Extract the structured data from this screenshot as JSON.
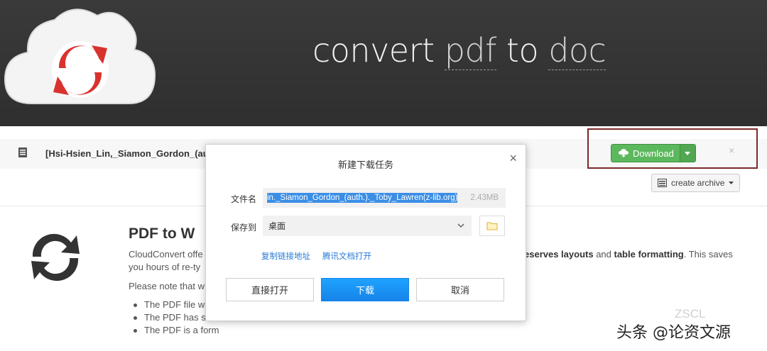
{
  "header": {
    "title_parts": [
      "convert",
      "pdf",
      "to",
      "doc"
    ]
  },
  "file": {
    "name": "[Hsi-Hsien_Lin,_Siamon_Gordon_(au"
  },
  "actions": {
    "download_label": "Download",
    "close_glyph": "×",
    "archive_label": "create archive"
  },
  "content": {
    "title": "PDF to W",
    "line1_left": "CloudConvert offe",
    "line1_right_bold1": "eserves layouts",
    "line1_right_mid": " and ",
    "line1_right_bold2": "table formatting",
    "line1_right_end": ". This saves",
    "line2": "you hours of re-ty",
    "note": "Please note that w",
    "bullets": [
      "The PDF file w",
      "The PDF has se",
      "The PDF is a form"
    ]
  },
  "dialog": {
    "title": "新建下载任务",
    "filename_label": "文件名",
    "filename_value": "in._Siamon_Gordon_(auth.)._Toby_Lawren(z-lib.org)",
    "file_size": "2.43MB",
    "save_label": "保存到",
    "save_path": "桌面",
    "link_copy": "复制链接地址",
    "link_tencent": "腾讯文档打开",
    "btn_open": "直接打开",
    "btn_download": "下载",
    "btn_cancel": "取消"
  },
  "watermark": {
    "text": "头条 @论资文源",
    "faint": "ZSCL"
  },
  "colors": {
    "header_bg": "#333333",
    "download_green": "#5cb85c",
    "highlight_border": "#7b2a2a",
    "dialog_primary": "#1684e8",
    "logo_red": "#d9322e"
  },
  "icons": {
    "logo": "cloud-sync-logo",
    "file": "file-icon",
    "download": "cloud-download-icon",
    "archive": "archive-icon",
    "sync": "sync-icon",
    "folder": "folder-icon",
    "dialog_close": "close-icon"
  }
}
